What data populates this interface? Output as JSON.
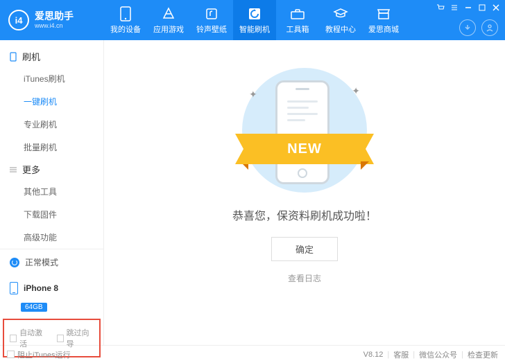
{
  "logo": {
    "badge": "i4",
    "title": "爱思助手",
    "subtitle": "www.i4.cn"
  },
  "top_tabs": [
    {
      "label": "我的设备"
    },
    {
      "label": "应用游戏"
    },
    {
      "label": "铃声壁纸"
    },
    {
      "label": "智能刷机"
    },
    {
      "label": "工具箱"
    },
    {
      "label": "教程中心"
    },
    {
      "label": "爱思商城"
    }
  ],
  "sidebar": {
    "section1": {
      "title": "刷机",
      "items": [
        "iTunes刷机",
        "一键刷机",
        "专业刷机",
        "批量刷机"
      ]
    },
    "section2": {
      "title": "更多",
      "items": [
        "其他工具",
        "下载固件",
        "高级功能"
      ]
    },
    "mode": "正常模式",
    "device": {
      "name": "iPhone 8",
      "storage": "64GB"
    },
    "checks": {
      "auto_activate": "自动激活",
      "skip_guide": "跳过向导"
    }
  },
  "main": {
    "ribbon": "NEW",
    "message": "恭喜您，保资料刷机成功啦！",
    "ok": "确定",
    "log": "查看日志"
  },
  "footer": {
    "block_itunes": "阻止iTunes运行",
    "version": "V8.12",
    "links": [
      "客服",
      "微信公众号",
      "检查更新"
    ]
  }
}
